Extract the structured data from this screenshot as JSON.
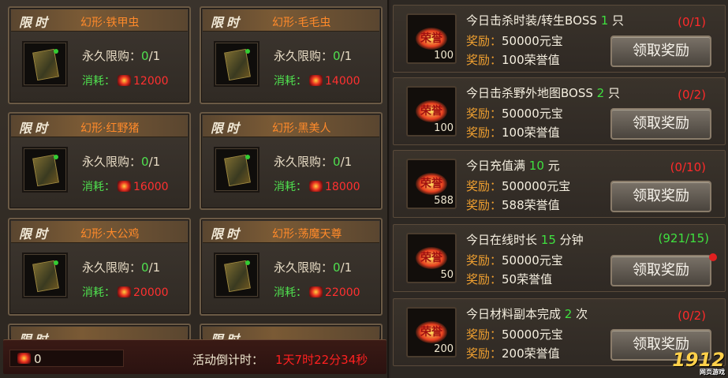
{
  "cards": [
    {
      "tag": "限时",
      "name": "幻形·铁甲虫",
      "limit_label": "永久限购：",
      "limit_cur": "0",
      "limit_max": "/1",
      "cost_label": "消耗：",
      "cost": "12000"
    },
    {
      "tag": "限时",
      "name": "幻形·毛毛虫",
      "limit_label": "永久限购：",
      "limit_cur": "0",
      "limit_max": "/1",
      "cost_label": "消耗：",
      "cost": "14000"
    },
    {
      "tag": "限时",
      "name": "幻形·红野猪",
      "limit_label": "永久限购：",
      "limit_cur": "0",
      "limit_max": "/1",
      "cost_label": "消耗：",
      "cost": "16000"
    },
    {
      "tag": "限时",
      "name": "幻形·黑美人",
      "limit_label": "永久限购：",
      "limit_cur": "0",
      "limit_max": "/1",
      "cost_label": "消耗：",
      "cost": "18000"
    },
    {
      "tag": "限时",
      "name": "幻形·大公鸡",
      "limit_label": "永久限购：",
      "limit_cur": "0",
      "limit_max": "/1",
      "cost_label": "消耗：",
      "cost": "20000"
    },
    {
      "tag": "限时",
      "name": "幻形·荡魔天尊",
      "limit_label": "永久限购：",
      "limit_cur": "0",
      "limit_max": "/1",
      "cost_label": "消耗：",
      "cost": "22000"
    },
    {
      "tag": "限时"
    },
    {
      "tag": "限时"
    }
  ],
  "footer": {
    "balance": "0",
    "countdown_label": "活动倒计时：",
    "countdown": "1天7时22分34秒"
  },
  "tasks": [
    {
      "icon_text": "荣誉",
      "icon_count": "100",
      "title_a": "今日击杀时装/转生BOSS ",
      "title_num": "1",
      "title_b": " 只",
      "progress": "(0/1)",
      "r1_label": "奖励：",
      "r1": "50000元宝",
      "r2_label": "奖励：",
      "r2": "100荣誉值",
      "button": "领取奖励"
    },
    {
      "icon_text": "荣誉",
      "icon_count": "100",
      "title_a": "今日击杀野外地图BOSS ",
      "title_num": "2",
      "title_b": " 只",
      "progress": "(0/2)",
      "r1_label": "奖励：",
      "r1": "50000元宝",
      "r2_label": "奖励：",
      "r2": "100荣誉值",
      "button": "领取奖励"
    },
    {
      "icon_text": "荣誉",
      "icon_count": "588",
      "title_a": "今日充值满 ",
      "title_num": "10",
      "title_b": " 元",
      "progress": "(0/10)",
      "r1_label": "奖励：",
      "r1": "500000元宝",
      "r2_label": "奖励：",
      "r2": "588荣誉值",
      "button": "领取奖励"
    },
    {
      "icon_text": "荣誉",
      "icon_count": "50",
      "title_a": "今日在线时长 ",
      "title_num": "15",
      "title_b": " 分钟",
      "progress": "(921/15)",
      "r1_label": "奖励：",
      "r1": "50000元宝",
      "r2_label": "奖励：",
      "r2": "50荣誉值",
      "button": "领取奖励"
    },
    {
      "icon_text": "荣誉",
      "icon_count": "200",
      "title_a": "今日材料副本完成 ",
      "title_num": "2",
      "title_b": " 次",
      "progress": "(0/2)",
      "r1_label": "奖励：",
      "r1": "50000元宝",
      "r2_label": "奖励：",
      "r2": "200荣誉值",
      "button": "领取奖励"
    }
  ],
  "logo": {
    "text": "1912",
    "sub": "网页游戏",
    "badge": "yx"
  },
  "colors": {
    "accent": "#ff8a2a",
    "green": "#3fe03f",
    "red": "#ff2a2a"
  }
}
